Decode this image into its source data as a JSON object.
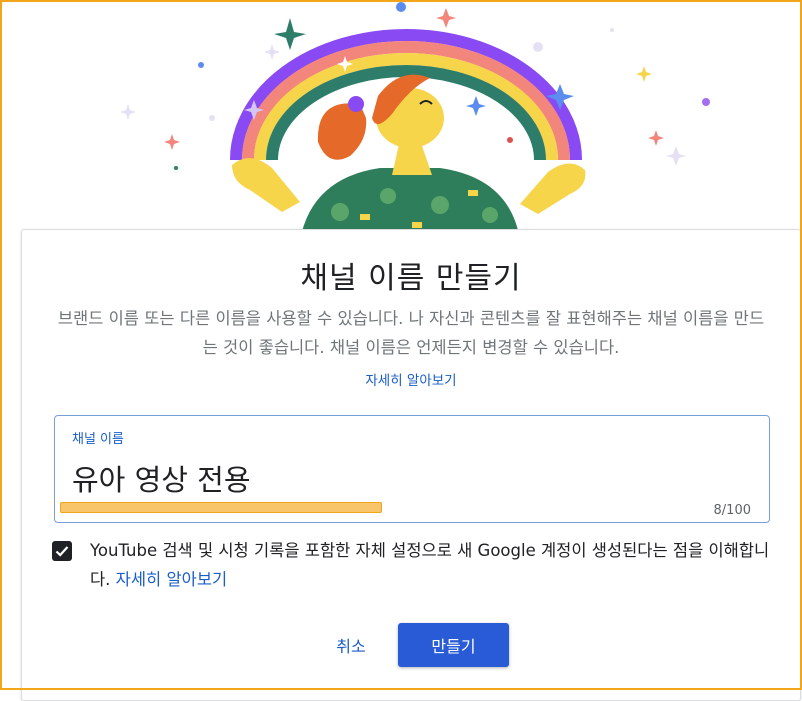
{
  "dialog": {
    "title": "채널 이름 만들기",
    "description": "브랜드 이름 또는 다른 이름을 사용할 수 있습니다. 나 자신과 콘텐츠를 잘 표현해주는 채널 이름을 만드는 것이 좋습니다. 채널 이름은 언제든지 변경할 수 있습니다.",
    "learn_more": "자세히 알아보기"
  },
  "name_field": {
    "label": "채널 이름",
    "value": "유아 영상 전용",
    "counter": "8/100"
  },
  "consent": {
    "checked": true,
    "text": "YouTube 검색 및 시청 기록을 포함한 자체 설정으로 새 Google 계정이 생성된다는 점을 이해합니다. ",
    "link": "자세히 알아보기"
  },
  "actions": {
    "cancel_label": "취소",
    "create_label": "만들기"
  },
  "colors": {
    "primary": "#2a5bd7",
    "link": "#1a5ec7",
    "highlight_border": "#f2a51b",
    "rainbow": [
      "#8a4af3",
      "#f2857c",
      "#f7d54a",
      "#2e7d6b"
    ]
  }
}
